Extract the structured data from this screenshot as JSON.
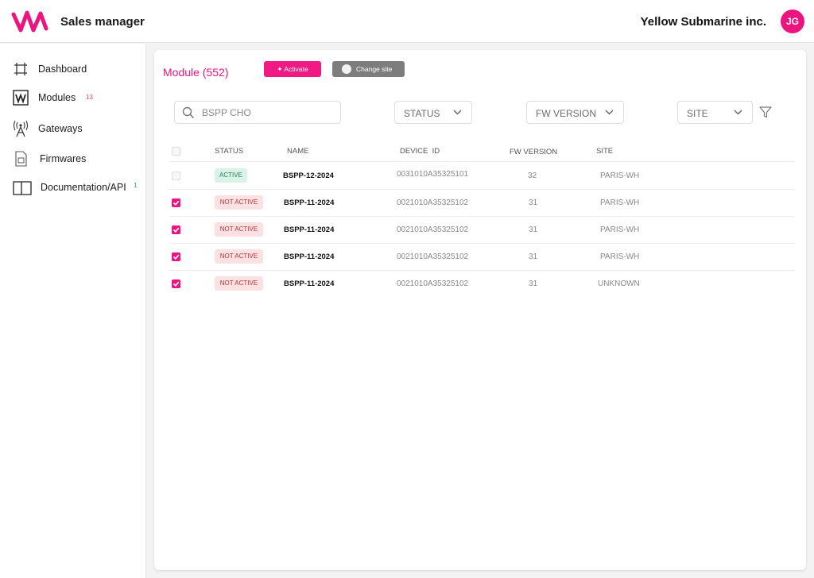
{
  "header": {
    "app_title": "Sales manager",
    "company": "Yellow Submarine inc.",
    "avatar_initials": "JG",
    "brand_color": "#ec1580"
  },
  "sidebar": {
    "items": [
      {
        "label": "Dashboard",
        "icon": "dashboard-icon"
      },
      {
        "label": "Modules",
        "icon": "modules-icon",
        "badge": "13"
      },
      {
        "label": "Gateways",
        "icon": "antenna-icon"
      },
      {
        "label": "Firmwares",
        "icon": "firmware-file-icon"
      },
      {
        "label": "Documentation/API",
        "icon": "book-icon",
        "badge": "1"
      }
    ]
  },
  "main": {
    "title": "Module (552)",
    "activate_label": "Activate",
    "change_site_label": "Change site",
    "search": {
      "value": "",
      "placeholder": "BSPP CHO"
    },
    "filters": {
      "status": "STATUS",
      "fw_version": "FW VERSION",
      "site": "SITE"
    }
  },
  "table": {
    "columns": [
      "STATUS",
      "NAME",
      "DEVICE  ID",
      "FW VERSION",
      "SITE"
    ],
    "rows": [
      {
        "checked": false,
        "status": "ACTIVE",
        "name": "BSPP-12-2024",
        "device_id": "0031010A35325101",
        "fw": "32",
        "site": "PARIS-WH"
      },
      {
        "checked": true,
        "status": "NOT ACTIVE",
        "name": "BSPP-11-2024",
        "device_id": "0021010A35325102",
        "fw": "31",
        "site": "PARIS-WH"
      },
      {
        "checked": true,
        "status": "NOT ACTIVE",
        "name": "BSPP-11-2024",
        "device_id": "0021010A35325102",
        "fw": "31",
        "site": "PARIS-WH"
      },
      {
        "checked": true,
        "status": "NOT ACTIVE",
        "name": "BSPP-11-2024",
        "device_id": "0021010A35325102",
        "fw": "31",
        "site": "PARIS-WH"
      },
      {
        "checked": true,
        "status": "NOT ACTIVE",
        "name": "BSPP-11-2024",
        "device_id": "0021010A35325102",
        "fw": "31",
        "site": "UNKNOWN"
      }
    ]
  }
}
